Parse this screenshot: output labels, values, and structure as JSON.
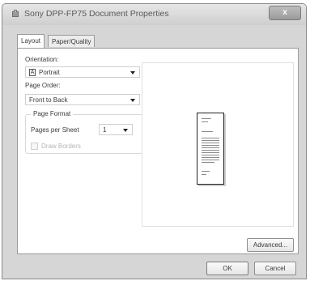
{
  "window": {
    "title": "Sony DPP-FP75 Document Properties",
    "close_symbol": "x"
  },
  "tabs": [
    {
      "label": "Layout",
      "active": true
    },
    {
      "label": "Paper/Quality",
      "active": false
    }
  ],
  "layout": {
    "orientation_label": "Orientation:",
    "orientation_value": "Portrait",
    "orientation_icon_glyph": "A",
    "page_order_label": "Page Order:",
    "page_order_value": "Front to Back",
    "page_format": {
      "legend": "Page Format",
      "pages_per_sheet_label": "Pages per Sheet",
      "pages_per_sheet_value": "1",
      "draw_borders_label": "Draw Borders",
      "draw_borders_checked": false,
      "draw_borders_enabled": false
    }
  },
  "buttons": {
    "advanced": "Advanced...",
    "ok": "OK",
    "cancel": "Cancel"
  },
  "icons": {
    "app": "printer-icon",
    "orientation": "portrait-orientation-icon",
    "preview": "document-preview-icon",
    "dropdown": "chevron-down-icon"
  }
}
